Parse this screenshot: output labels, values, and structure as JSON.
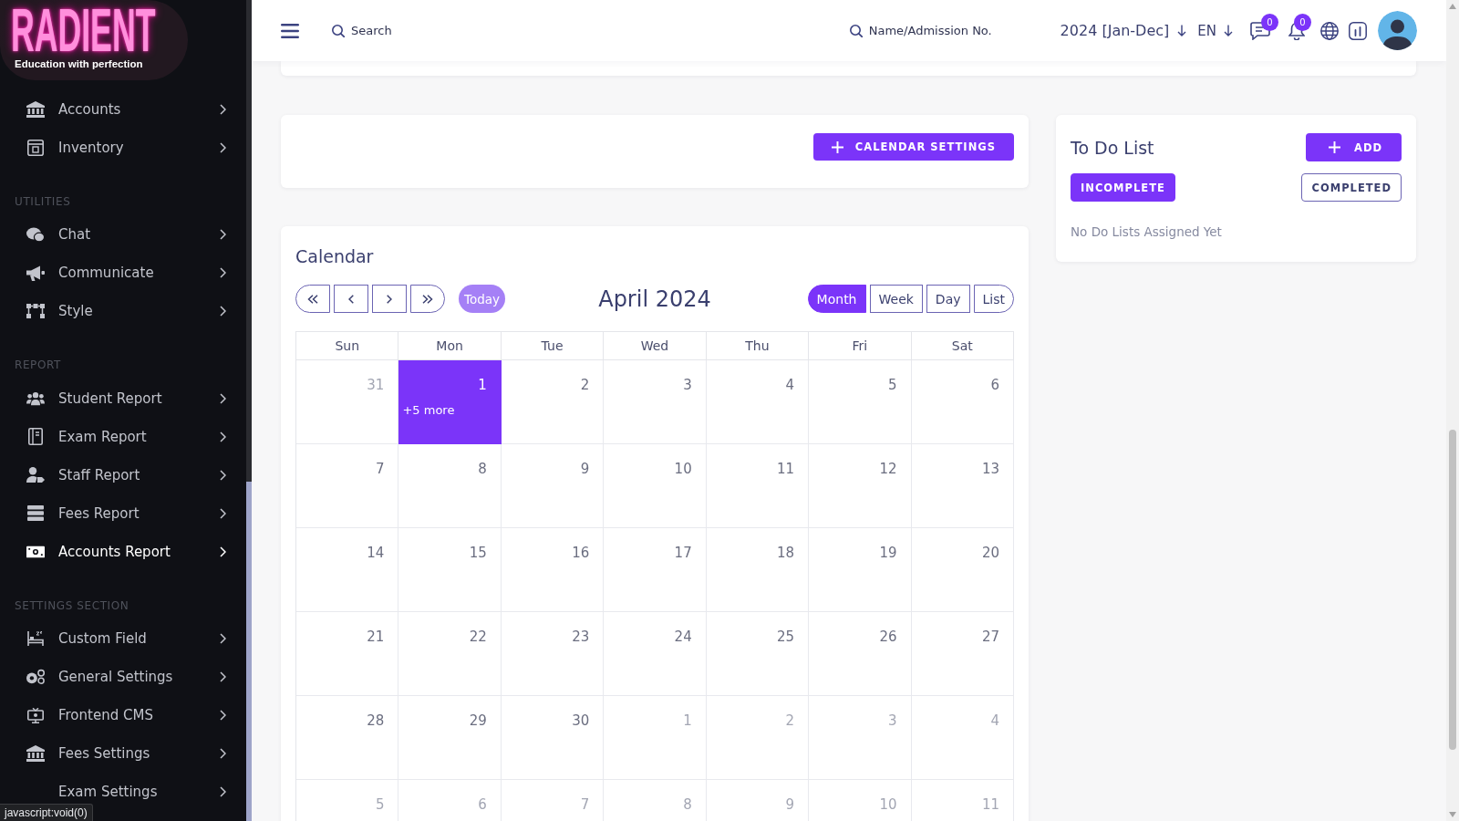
{
  "sidebar": {
    "logo": {
      "title": "RADIENT",
      "tagline": "Education with perfection"
    },
    "sections": [
      {
        "items": [
          {
            "label": "Accounts",
            "selected": false
          },
          {
            "label": "Inventory",
            "selected": false
          }
        ]
      },
      {
        "heading": "UTILITIES",
        "items": [
          {
            "label": "Chat",
            "selected": false
          },
          {
            "label": "Communicate",
            "selected": false
          },
          {
            "label": "Style",
            "selected": false
          }
        ]
      },
      {
        "heading": "REPORT",
        "items": [
          {
            "label": "Student Report",
            "selected": false
          },
          {
            "label": "Exam Report",
            "selected": false
          },
          {
            "label": "Staff Report",
            "selected": false
          },
          {
            "label": "Fees Report",
            "selected": false
          },
          {
            "label": "Accounts Report",
            "selected": true
          }
        ]
      },
      {
        "heading": "SETTINGS SECTION",
        "items": [
          {
            "label": "Custom Field",
            "selected": false
          },
          {
            "label": "General Settings",
            "selected": false
          },
          {
            "label": "Frontend CMS",
            "selected": false
          },
          {
            "label": "Fees Settings",
            "selected": false
          },
          {
            "label": "Exam Settings",
            "selected": false
          }
        ]
      }
    ]
  },
  "topbar": {
    "search": {
      "placeholder": "Search"
    },
    "student_search": {
      "placeholder": "Name/Admission No."
    },
    "session": "2024 [Jan-Dec]",
    "language": "EN",
    "messages": {
      "count": "0"
    },
    "notifications": {
      "count": "0"
    }
  },
  "settings_card": {
    "button": "CALENDAR SETTINGS"
  },
  "todo": {
    "title": "To Do List",
    "add_button": "ADD",
    "tabs": [
      {
        "label": "INCOMPLETE",
        "selected": true
      },
      {
        "label": "COMPLETED",
        "selected": false
      }
    ],
    "empty_message": "No Do Lists Assigned Yet"
  },
  "calendar": {
    "title": "Calendar",
    "today_button": {
      "label": "Today",
      "disabled": true
    },
    "month_label": "April 2024",
    "views": [
      {
        "label": "Month",
        "selected": true
      },
      {
        "label": "Week",
        "selected": false
      },
      {
        "label": "Day",
        "selected": false
      },
      {
        "label": "List",
        "selected": false
      }
    ],
    "weekdays": [
      "Sun",
      "Mon",
      "Tue",
      "Wed",
      "Thu",
      "Fri",
      "Sat"
    ],
    "weeks": [
      [
        {
          "day": "31",
          "outside": true,
          "today": false
        },
        {
          "day": "1",
          "outside": false,
          "today": true,
          "more": "+5 more"
        },
        {
          "day": "2",
          "outside": false,
          "today": false
        },
        {
          "day": "3",
          "outside": false,
          "today": false
        },
        {
          "day": "4",
          "outside": false,
          "today": false
        },
        {
          "day": "5",
          "outside": false,
          "today": false
        },
        {
          "day": "6",
          "outside": false,
          "today": false
        }
      ],
      [
        {
          "day": "7",
          "outside": false,
          "today": false
        },
        {
          "day": "8",
          "outside": false,
          "today": false
        },
        {
          "day": "9",
          "outside": false,
          "today": false
        },
        {
          "day": "10",
          "outside": false,
          "today": false
        },
        {
          "day": "11",
          "outside": false,
          "today": false
        },
        {
          "day": "12",
          "outside": false,
          "today": false
        },
        {
          "day": "13",
          "outside": false,
          "today": false
        }
      ],
      [
        {
          "day": "14",
          "outside": false,
          "today": false
        },
        {
          "day": "15",
          "outside": false,
          "today": false
        },
        {
          "day": "16",
          "outside": false,
          "today": false
        },
        {
          "day": "17",
          "outside": false,
          "today": false
        },
        {
          "day": "18",
          "outside": false,
          "today": false
        },
        {
          "day": "19",
          "outside": false,
          "today": false
        },
        {
          "day": "20",
          "outside": false,
          "today": false
        }
      ],
      [
        {
          "day": "21",
          "outside": false,
          "today": false
        },
        {
          "day": "22",
          "outside": false,
          "today": false
        },
        {
          "day": "23",
          "outside": false,
          "today": false
        },
        {
          "day": "24",
          "outside": false,
          "today": false
        },
        {
          "day": "25",
          "outside": false,
          "today": false
        },
        {
          "day": "26",
          "outside": false,
          "today": false
        },
        {
          "day": "27",
          "outside": false,
          "today": false
        }
      ],
      [
        {
          "day": "28",
          "outside": false,
          "today": false
        },
        {
          "day": "29",
          "outside": false,
          "today": false
        },
        {
          "day": "30",
          "outside": false,
          "today": false
        },
        {
          "day": "1",
          "outside": true,
          "today": false
        },
        {
          "day": "2",
          "outside": true,
          "today": false
        },
        {
          "day": "3",
          "outside": true,
          "today": false
        },
        {
          "day": "4",
          "outside": true,
          "today": false
        }
      ],
      [
        {
          "day": "5",
          "outside": true,
          "today": false
        },
        {
          "day": "6",
          "outside": true,
          "today": false
        },
        {
          "day": "7",
          "outside": true,
          "today": false
        },
        {
          "day": "8",
          "outside": true,
          "today": false
        },
        {
          "day": "9",
          "outside": true,
          "today": false
        },
        {
          "day": "10",
          "outside": true,
          "today": false
        },
        {
          "day": "11",
          "outside": true,
          "today": false
        }
      ]
    ]
  },
  "status_bar": {
    "text": "javascript:void(0)"
  }
}
